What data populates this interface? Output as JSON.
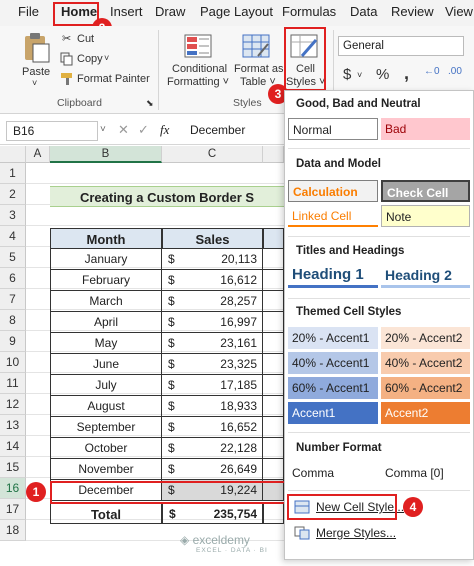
{
  "menu": {
    "items": [
      "File",
      "Home",
      "Insert",
      "Draw",
      "Page Layout",
      "Formulas",
      "Data",
      "Review",
      "View"
    ]
  },
  "ribbon": {
    "paste": "Paste",
    "cut": "Cut",
    "copy": "Copy",
    "format_painter": "Format Painter",
    "clipboard_group": "Clipboard",
    "conditional_formatting": [
      "Conditional",
      "Formatting ˅"
    ],
    "format_as_table": [
      "Format as",
      "Table ˅"
    ],
    "cell_styles": [
      "Cell",
      "Styles ˅"
    ],
    "styles_group": "Styles",
    "number_format": "General",
    "currency_symbol": "$",
    "percent_symbol": "%",
    "comma_symbol": ","
  },
  "formula_bar": {
    "name_box": "B16",
    "fx": "fx",
    "content": "December"
  },
  "sheet": {
    "columns": [
      "A",
      "B",
      "C"
    ],
    "rows": [
      "1",
      "2",
      "3",
      "4",
      "5",
      "6",
      "7",
      "8",
      "9",
      "10",
      "11",
      "12",
      "13",
      "14",
      "15",
      "16",
      "17",
      "18"
    ],
    "title": "Creating a Custom Border S",
    "header": {
      "month": "Month",
      "sales": "Sales"
    },
    "data": [
      {
        "month": "January",
        "cur": "$",
        "sales": "20,113"
      },
      {
        "month": "February",
        "cur": "$",
        "sales": "16,612"
      },
      {
        "month": "March",
        "cur": "$",
        "sales": "28,257"
      },
      {
        "month": "April",
        "cur": "$",
        "sales": "16,997"
      },
      {
        "month": "May",
        "cur": "$",
        "sales": "23,161"
      },
      {
        "month": "June",
        "cur": "$",
        "sales": "23,325"
      },
      {
        "month": "July",
        "cur": "$",
        "sales": "17,185"
      },
      {
        "month": "August",
        "cur": "$",
        "sales": "18,933"
      },
      {
        "month": "September",
        "cur": "$",
        "sales": "16,652"
      },
      {
        "month": "October",
        "cur": "$",
        "sales": "22,128"
      },
      {
        "month": "November",
        "cur": "$",
        "sales": "26,649"
      },
      {
        "month": "December",
        "cur": "$",
        "sales": "19,224"
      }
    ],
    "total": {
      "label": "Total",
      "cur": "$",
      "value": "235,754"
    }
  },
  "panel": {
    "sec_good_bad": "Good, Bad and Neutral",
    "normal": "Normal",
    "bad": "Bad",
    "sec_data_model": "Data and Model",
    "calculation": "Calculation",
    "check_cell": "Check Cell",
    "linked_cell": "Linked Cell",
    "note": "Note",
    "sec_titles": "Titles and Headings",
    "heading1": "Heading 1",
    "heading2": "Heading 2",
    "sec_themed": "Themed Cell Styles",
    "a20_1": "20% - Accent1",
    "a20_2": "20% - Accent2",
    "a40_1": "40% - Accent1",
    "a40_2": "40% - Accent2",
    "a60_1": "60% - Accent1",
    "a60_2": "60% - Accent2",
    "accent1": "Accent1",
    "accent2": "Accent2",
    "sec_number": "Number Format",
    "comma": "Comma",
    "comma0": "Comma [0]",
    "new_cell_style": "New Cell Style...",
    "merge_styles": "Merge Styles..."
  },
  "badges": [
    "1",
    "2",
    "3",
    "4"
  ],
  "watermark": {
    "brand": "exceldemy",
    "tagline": "EXCEL · DATA · BI"
  },
  "colors": {
    "accent_red": "#e02020",
    "table_header": "#dce6f1",
    "title_fill": "#e2efda",
    "selected_row": "#d9d9d9"
  }
}
